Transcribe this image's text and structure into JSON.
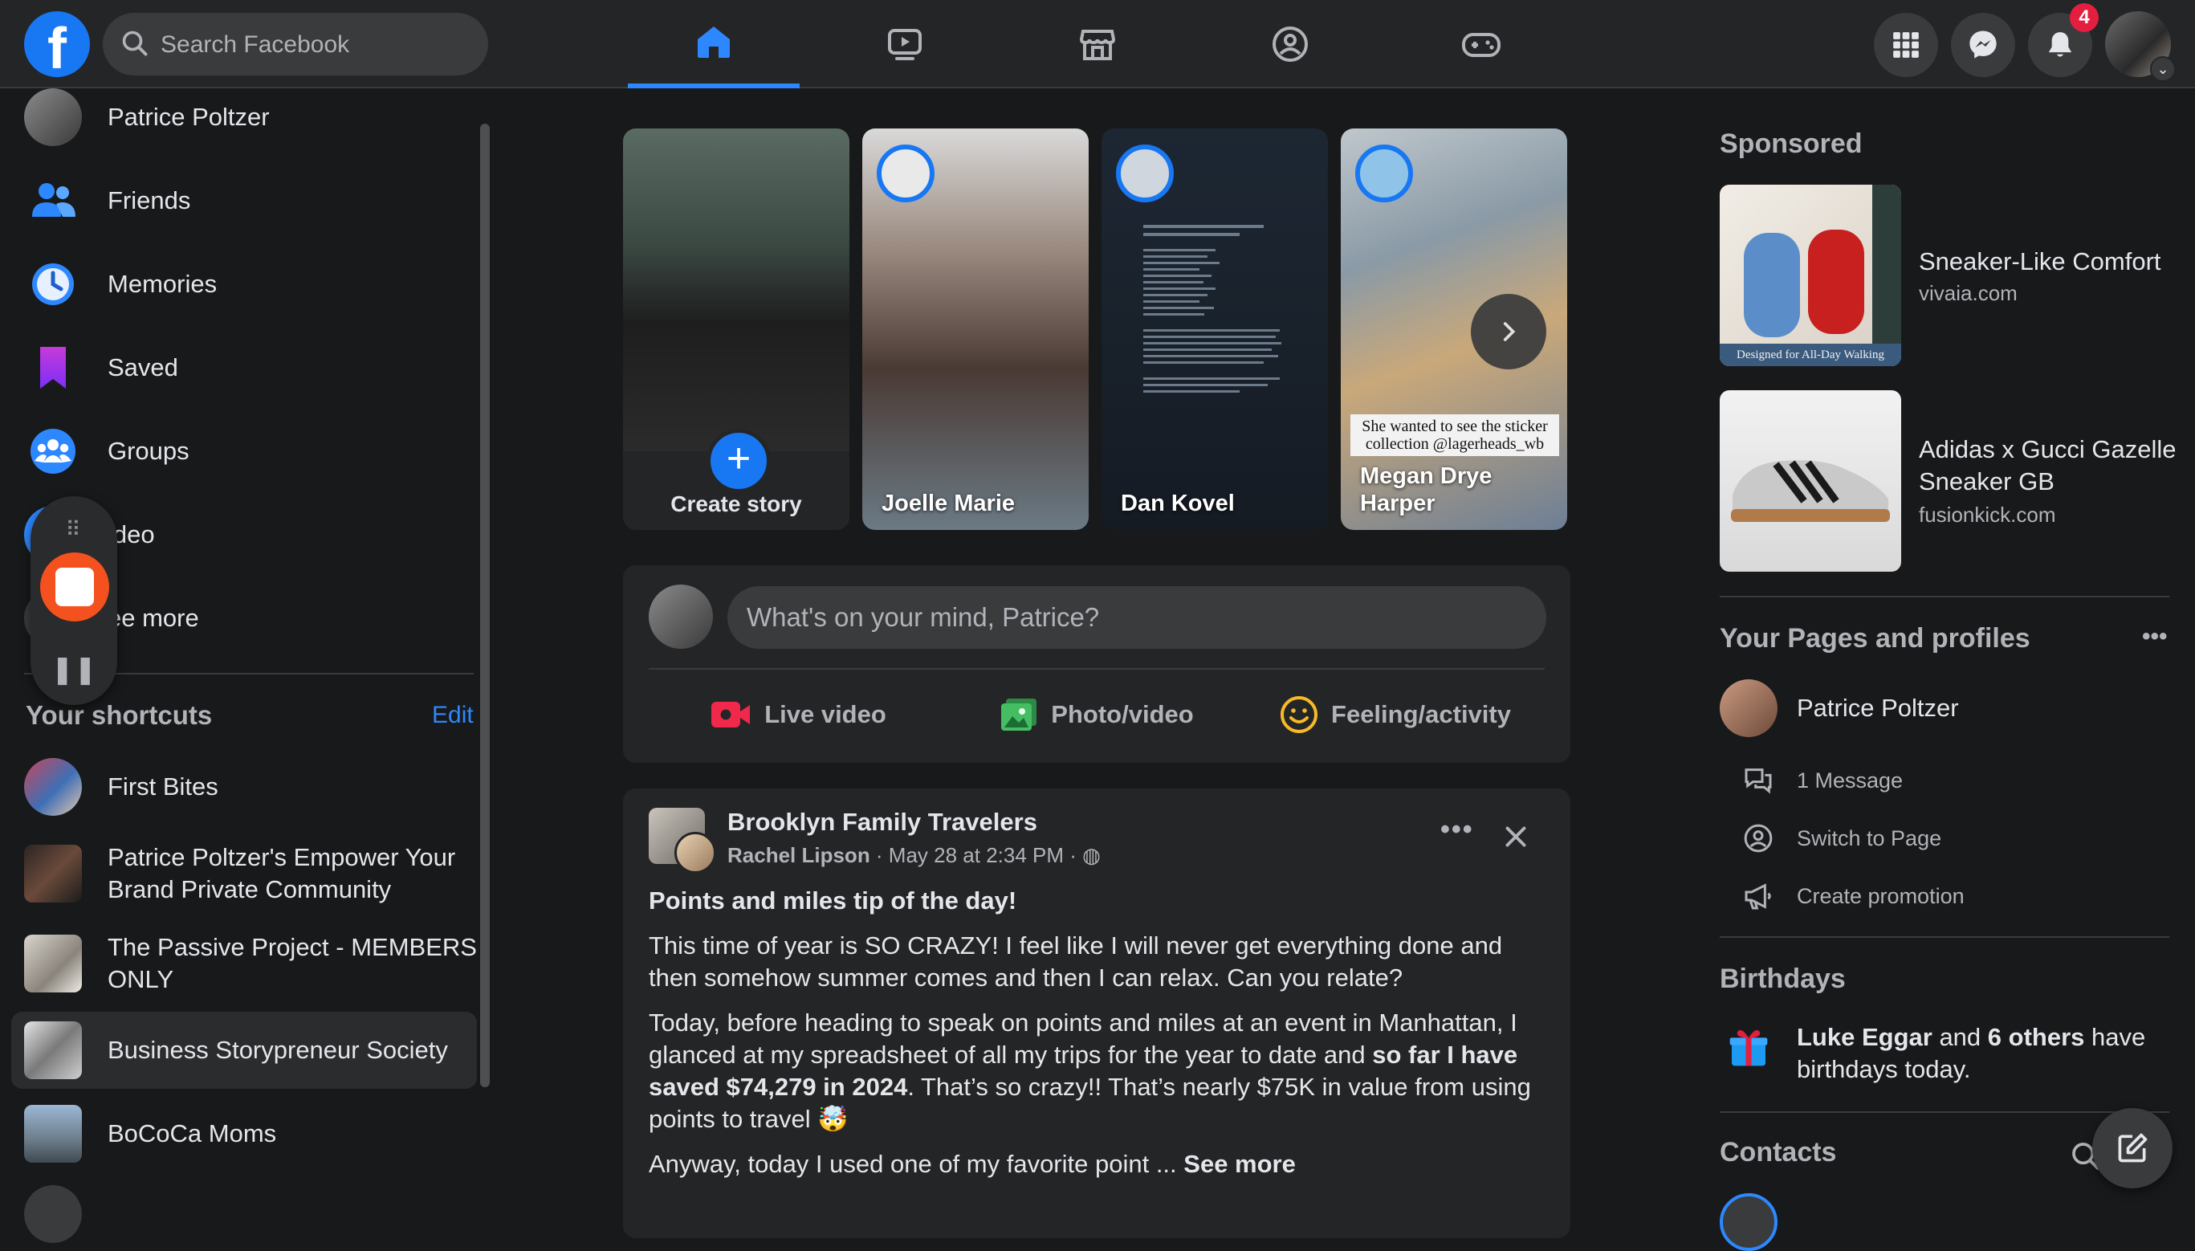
{
  "topbar": {
    "search_placeholder": "Search Facebook",
    "notifications_count": "4"
  },
  "sidebar": {
    "items": [
      {
        "label": "Patrice Poltzer",
        "icon": "profile-avatar"
      },
      {
        "label": "Friends",
        "icon": "friends-icon"
      },
      {
        "label": "Memories",
        "icon": "memories-icon"
      },
      {
        "label": "Saved",
        "icon": "saved-icon"
      },
      {
        "label": "Groups",
        "icon": "groups-icon"
      },
      {
        "label": "ideo",
        "icon": "video-icon"
      },
      {
        "label": "ee more",
        "icon": "see-more-icon"
      }
    ],
    "shortcuts_title": "Your shortcuts",
    "edit_label": "Edit",
    "shortcuts": [
      {
        "label": "First Bites"
      },
      {
        "label": "Patrice Poltzer's Empower Your Brand Private Community"
      },
      {
        "label": "The Passive Project - MEMBERS ONLY"
      },
      {
        "label": "Business Storypreneur Society"
      },
      {
        "label": "BoCoCa Moms"
      }
    ]
  },
  "stories": [
    {
      "name": "Create story"
    },
    {
      "name": "Joelle Marie"
    },
    {
      "name": "Dan Kovel"
    },
    {
      "name": "Megan Drye Harper",
      "sticker": "She wanted to see the sticker collection @lagerheads_wb"
    }
  ],
  "composer": {
    "placeholder": "What's on your mind, Patrice?",
    "buttons": [
      {
        "label": "Live video",
        "color": "#f02849"
      },
      {
        "label": "Photo/video",
        "color": "#45bd62"
      },
      {
        "label": "Feeling/activity",
        "color": "#f7b928"
      }
    ]
  },
  "post": {
    "group": "Brooklyn Family Travelers",
    "author": "Rachel Lipson",
    "meta": " · May 28 at 2:34 PM · ",
    "headline": "Points and miles tip of the day!",
    "para1": "This time of year is SO CRAZY! I feel like I will never get everything done and then somehow summer comes and then I can relax. Can you relate?",
    "para2_before": "Today, before heading to speak on points and miles at an event in Manhattan, I glanced at my spreadsheet of all my trips for the year to date and ",
    "para2_bold": "so far I have saved $74,279 in 2024",
    "para2_after": ". That’s so crazy!! That’s nearly $75K in value from using points to travel 🤯",
    "para3": "Anyway, today I used one of my favorite point ... ",
    "see_more": "See more"
  },
  "right": {
    "sponsored_title": "Sponsored",
    "ads": [
      {
        "title": "Sneaker-Like Comfort",
        "domain": "vivaia.com",
        "image_caption": "Designed for All-Day Walking"
      },
      {
        "title": "Adidas x Gucci Gazelle Sneaker GB",
        "domain": "fusionkick.com"
      }
    ],
    "pages_title": "Your Pages and profiles",
    "page_name": "Patrice Poltzer",
    "page_actions": [
      "1 Message",
      "Switch to Page",
      "Create promotion"
    ],
    "birthdays_title": "Birthdays",
    "birthday_name": "Luke Eggar",
    "birthday_mid": " and ",
    "birthday_others": "6 others",
    "birthday_end": " have birthdays today.",
    "contacts_title": "Contacts"
  }
}
